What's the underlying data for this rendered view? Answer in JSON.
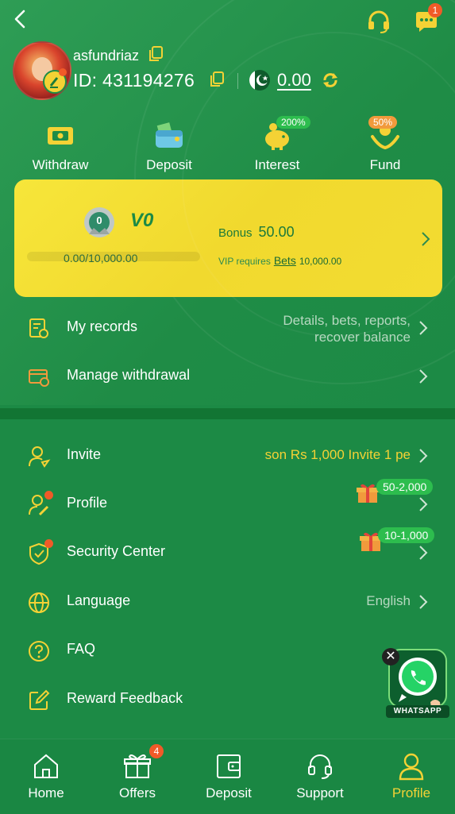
{
  "header": {
    "back_icon": "chevron-left-icon",
    "support_icon": "headset-icon",
    "messages_icon": "chat-bubble-icon",
    "messages_badge": "1"
  },
  "user": {
    "username": "asfundriaz",
    "id_label": "ID:",
    "id": "431194276",
    "balance": "0.00",
    "currency_flag": "pakistan-flag-icon"
  },
  "quick_actions": [
    {
      "label": "Withdraw",
      "icon": "ticket-icon",
      "tag": ""
    },
    {
      "label": "Deposit",
      "icon": "wallet-icon",
      "tag": ""
    },
    {
      "label": "Interest",
      "icon": "piggy-bank-icon",
      "tag": "200%"
    },
    {
      "label": "Fund",
      "icon": "hand-coins-icon",
      "tag": "50%"
    }
  ],
  "vip": {
    "level_num": "0",
    "level_name": "V0",
    "progress_text": "0.00/10,000.00",
    "progress_fraction": 0,
    "bonus_label": "Bonus",
    "bonus_value": "50.00",
    "requires_label": "VIP requires",
    "requires_link": "Bets",
    "requires_value": "10,000.00"
  },
  "records": {
    "label": "My records",
    "sub": "Details, bets, reports,",
    "sub2": "recover balance"
  },
  "manage_withdrawal": {
    "label": "Manage withdrawal"
  },
  "menu": {
    "invite": {
      "label": "Invite",
      "right": "son Rs 1,000  Invite 1 pe"
    },
    "profile": {
      "label": "Profile",
      "gift": "50-2,000"
    },
    "security": {
      "label": "Security Center",
      "gift": "10-1,000"
    },
    "language": {
      "label": "Language",
      "right": "English"
    },
    "faq": {
      "label": "FAQ"
    },
    "feedback": {
      "label": "Reward Feedback"
    }
  },
  "whatsapp": {
    "label": "WHATSAPP"
  },
  "nav": [
    {
      "label": "Home",
      "icon": "home-icon",
      "badge": ""
    },
    {
      "label": "Offers",
      "icon": "gift-icon",
      "badge": "4"
    },
    {
      "label": "Deposit",
      "icon": "wallet-icon",
      "badge": ""
    },
    {
      "label": "Support",
      "icon": "headset-icon",
      "badge": ""
    },
    {
      "label": "Profile",
      "icon": "person-icon",
      "badge": ""
    }
  ],
  "colors": {
    "accent": "#f4d235",
    "background": "#1c8a45",
    "badge": "#f05a28",
    "pill": "#2dbd4e"
  }
}
